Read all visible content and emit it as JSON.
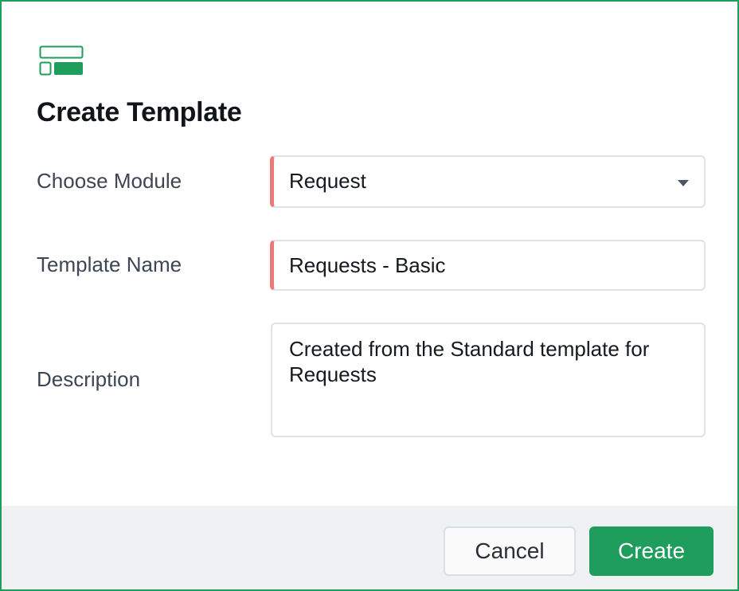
{
  "dialog": {
    "icon": "template-layout-icon",
    "title": "Create Template",
    "accent_color": "#1e9e5a",
    "required_marker_color": "#ea7b7b"
  },
  "form": {
    "module": {
      "label": "Choose Module",
      "value": "Request",
      "required": true
    },
    "template_name": {
      "label": "Template Name",
      "value": "Requests - Basic",
      "required": true
    },
    "description": {
      "label": "Description",
      "value": "Created from the Standard template for Requests"
    }
  },
  "footer": {
    "cancel_label": "Cancel",
    "create_label": "Create"
  }
}
